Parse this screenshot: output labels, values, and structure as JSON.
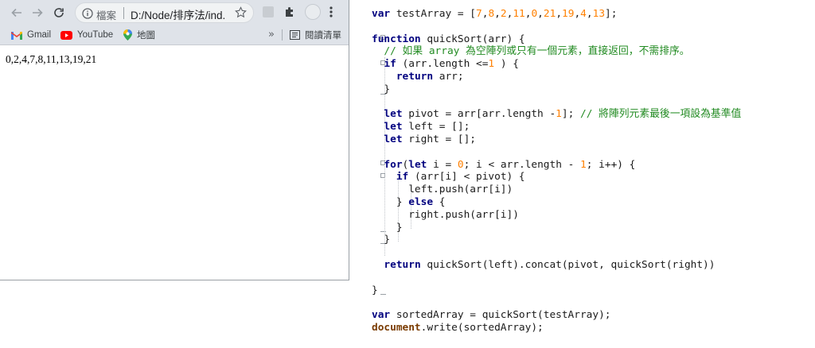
{
  "browser": {
    "toolbar": {
      "back_icon": "back-arrow-icon",
      "forward_icon": "forward-arrow-icon",
      "reload_icon": "reload-icon",
      "address": {
        "scheme_label": "檔案",
        "url": "D:/Node/排序法/ind..."
      }
    },
    "bookmarks": [
      {
        "label": "Gmail",
        "icon": "gmail-icon"
      },
      {
        "label": "YouTube",
        "icon": "youtube-icon"
      },
      {
        "label": "地圖",
        "icon": "maps-icon"
      }
    ],
    "bookmarks_more": "»",
    "reading_list_label": "閱讀清單",
    "page_output": "0,2,4,7,8,11,13,19,21"
  },
  "editor": {
    "lines": [
      "var testArray = [7,8,2,11,0,21,19,4,13];",
      "",
      "function quickSort(arr) {",
      "  // 如果 array 為空陣列或只有一個元素，直接返回，不需排序。",
      "  if (arr.length <=1 ) {",
      "    return arr;",
      "  }",
      "",
      "  let pivot = arr[arr.length -1]; // 將陣列元素最後一項設為基準值",
      "  let left = [];",
      "  let right = [];",
      "",
      "  for(let i = 0; i < arr.length - 1; i++) {",
      "    if (arr[i] < pivot) {",
      "      left.push(arr[i])",
      "    } else {",
      "      right.push(arr[i])",
      "    }",
      "  }",
      "",
      "  return quickSort(left).concat(pivot, quickSort(right))",
      "",
      "}",
      "",
      "var sortedArray = quickSort(testArray);",
      "document.write(sortedArray);"
    ]
  },
  "colors": {
    "keyword": "#00007f",
    "number": "#ff8000",
    "comment": "#228b22",
    "browser_chrome": "#dfe3e9"
  }
}
